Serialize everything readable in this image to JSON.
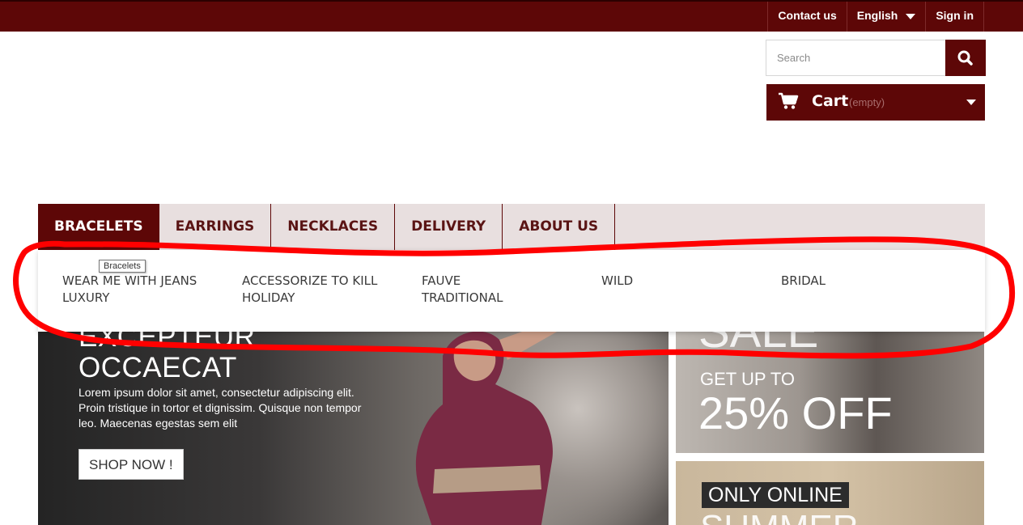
{
  "topbar": {
    "contact": "Contact us",
    "language": "English",
    "signin": "Sign in"
  },
  "search": {
    "placeholder": "Search"
  },
  "cart": {
    "title": "Cart",
    "status": "(empty)"
  },
  "menu": {
    "items": [
      "BRACELETS",
      "EARRINGS",
      "NECKLACES",
      "DELIVERY",
      "ABOUT US"
    ],
    "tooltip": "Bracelets",
    "submenu": [
      [
        "WEAR ME WITH JEANS",
        "LUXURY"
      ],
      [
        "ACCESSORIZE TO KILL",
        "HOLIDAY"
      ],
      [
        "FAUVE",
        "TRADITIONAL"
      ],
      [
        "WILD"
      ],
      [
        "BRIDAL"
      ]
    ]
  },
  "hero": {
    "title_line1": "EXCEPTEUR",
    "title_line2": "OCCAECAT",
    "text": "Lorem ipsum dolor sit amet, consectetur adipiscing elit. Proin tristique in tortor et dignissim. Quisque non tempor leo. Maecenas egestas sem elit",
    "button": "SHOP NOW !"
  },
  "banner_sale": {
    "headline": "SALE",
    "sub": "GET UP TO",
    "offer": "25% OFF"
  },
  "banner_online": {
    "tag": "ONLY ONLINE",
    "headline": "SUMMER"
  },
  "colors": {
    "brand": "#5d0707",
    "menu_bg": "#e8dfdf",
    "annotation": "#ff0000"
  },
  "icons": [
    "search-icon",
    "cart-icon",
    "chevron-down-icon"
  ]
}
